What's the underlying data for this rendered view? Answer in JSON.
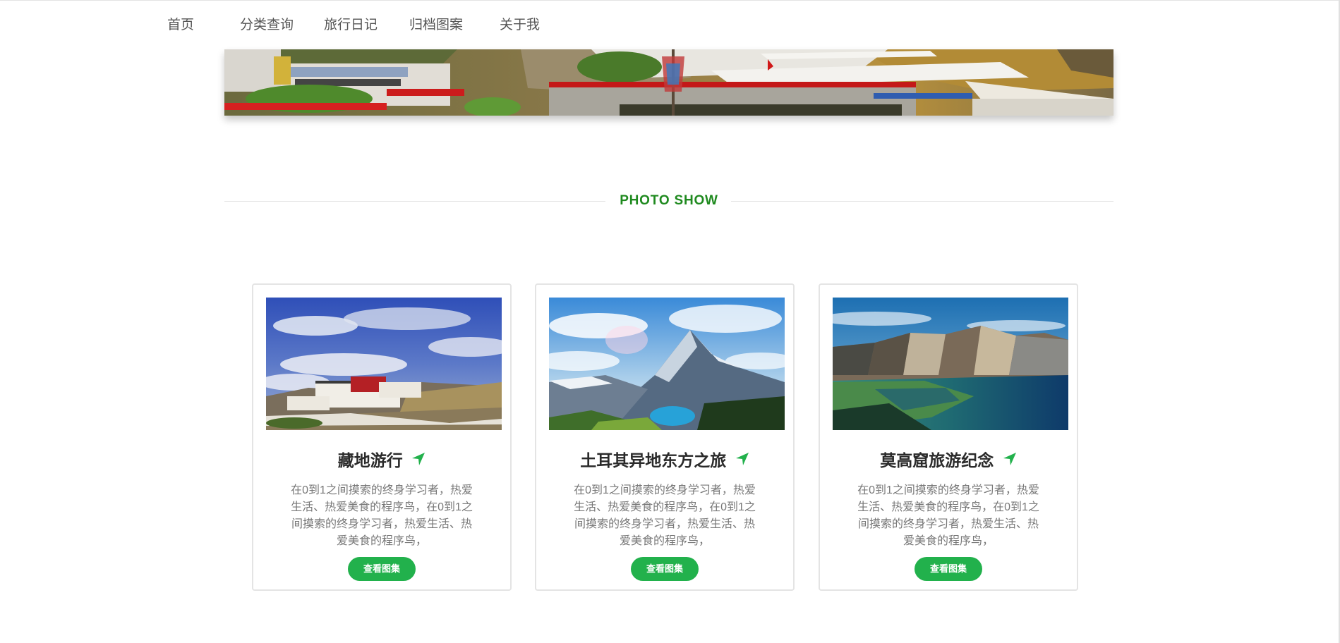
{
  "nav": {
    "items": [
      {
        "label": "首页"
      },
      {
        "label": "分类查询"
      },
      {
        "label": "旅行日记"
      },
      {
        "label": "归档图案"
      },
      {
        "label": "关于我"
      }
    ]
  },
  "section": {
    "title": "PHOTO SHOW"
  },
  "cards": [
    {
      "title": "藏地游行",
      "description": "在0到1之间摸索的终身学习者，热爱生活、热爱美食的程序鸟，在0到1之间摸索的终身学习者，热爱生活、热爱美食的程序鸟，",
      "button": "查看图集",
      "icon": "location-arrow-icon"
    },
    {
      "title": "土耳其异地东方之旅",
      "description": "在0到1之间摸索的终身学习者，热爱生活、热爱美食的程序鸟，在0到1之间摸索的终身学习者，热爱生活、热爱美食的程序鸟，",
      "button": "查看图集",
      "icon": "location-arrow-icon"
    },
    {
      "title": "莫高窟旅游纪念",
      "description": "在0到1之间摸索的终身学习者，热爱生活、热爱美食的程序鸟，在0到1之间摸索的终身学习者，热爱生活、热爱美食的程序鸟，",
      "button": "查看图集",
      "icon": "location-arrow-icon"
    }
  ],
  "colors": {
    "accent": "#22b14c",
    "section_title": "#1f8a1f",
    "nav_text": "#555555"
  }
}
